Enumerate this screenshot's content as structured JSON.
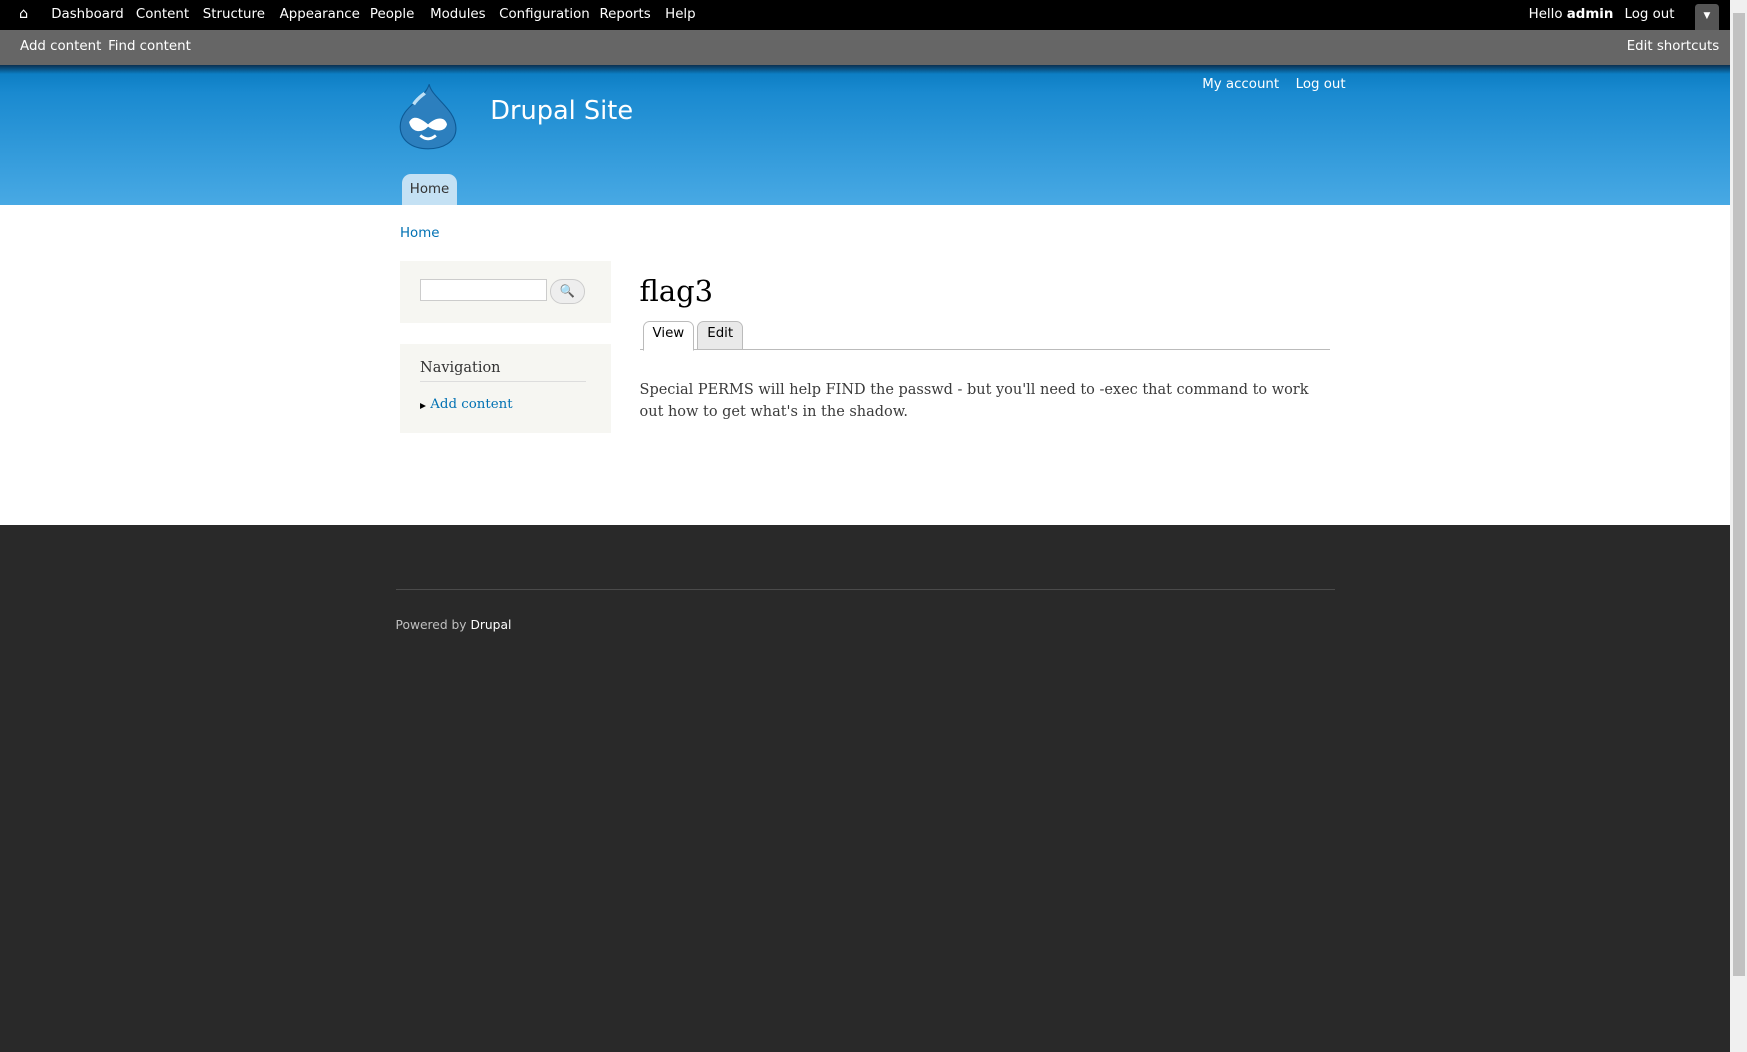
{
  "toolbar": {
    "items": [
      "Dashboard",
      "Content",
      "Structure",
      "Appearance",
      "People",
      "Modules",
      "Configuration",
      "Reports",
      "Help"
    ],
    "hello": "Hello ",
    "user": "admin",
    "logout": "Log out"
  },
  "shortcuts": {
    "items": [
      "Add content",
      "Find content"
    ],
    "edit": "Edit shortcuts"
  },
  "header": {
    "site_name": "Drupal Site",
    "secondary": [
      "My account",
      "Log out"
    ],
    "main_menu": [
      "Home"
    ]
  },
  "breadcrumb": [
    "Home"
  ],
  "search": {
    "value": "",
    "placeholder": ""
  },
  "navigation": {
    "title": "Navigation",
    "items": [
      "Add content"
    ]
  },
  "node": {
    "title": "flag3",
    "tabs": [
      "View",
      "Edit"
    ],
    "active_tab": "View",
    "body": "Special PERMS will help FIND the passwd - but you'll need to -exec that command to work out how to get what's in the shadow."
  },
  "footer": {
    "powered": "Powered by ",
    "drupal": "Drupal"
  }
}
